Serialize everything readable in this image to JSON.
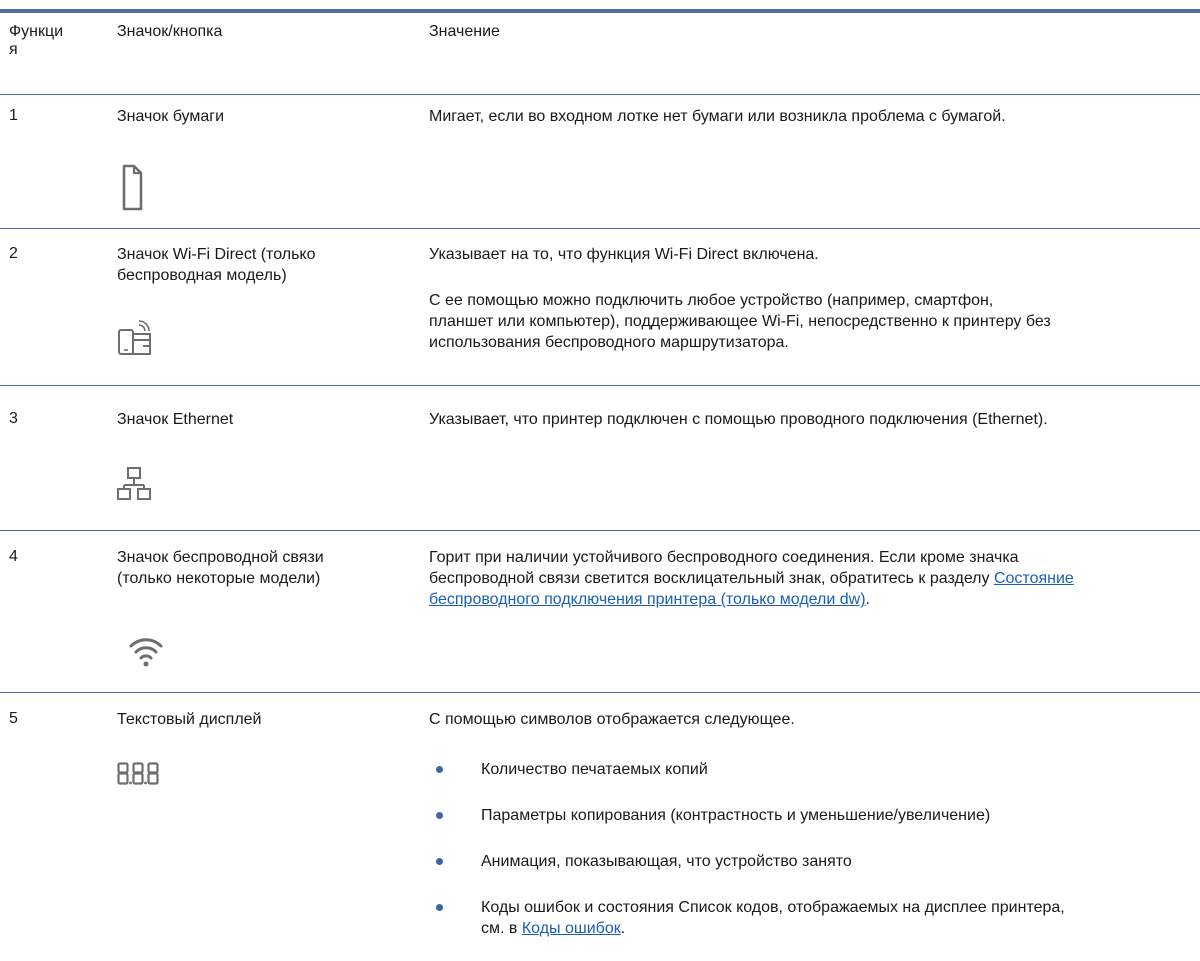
{
  "header": {
    "col_function": "Функци я",
    "col_function_line1": "Функци",
    "col_function_line2": "я",
    "col_icon": "Значок/кнопка",
    "col_meaning": "Значение"
  },
  "rows": [
    {
      "number": "1",
      "name": "Значок бумаги",
      "icon": "paper-icon",
      "meaning": "Мигает, если во входном лотке нет бумаги или возникла проблема с бумагой."
    },
    {
      "number": "2",
      "name_line1": "Значок Wi-Fi Direct (только",
      "name_line2": "беспроводная модель)",
      "icon": "wifi-direct-icon",
      "meaning_p1": "Указывает на то, что функция Wi-Fi Direct включена.",
      "meaning_p2_line1": "С ее помощью можно подключить любое устройство (например, смартфон,",
      "meaning_p2_line2": "планшет или компьютер), поддерживающее Wi-Fi, непосредственно к принтеру без",
      "meaning_p2_line3": "использования беспроводного маршрутизатора."
    },
    {
      "number": "3",
      "name": "Значок Ethernet",
      "icon": "ethernet-icon",
      "meaning": "Указывает, что принтер подключен с помощью проводного подключения (Ethernet)."
    },
    {
      "number": "4",
      "name_line1": "Значок беспроводной связи",
      "name_line2": "(только некоторые модели)",
      "icon": "wireless-icon",
      "meaning_line1": "Горит при наличии устойчивого беспроводного соединения. Если кроме значка",
      "meaning_line2_text": "беспроводной связи светится восклицательный знак, обратитесь к разделу ",
      "meaning_link_part1": "Состояние",
      "meaning_link_part2": "беспроводного подключения принтера (только модели dw)",
      "meaning_line3_tail": "."
    },
    {
      "number": "5",
      "name": "Текстовый дисплей",
      "icon": "segment-display-icon",
      "meaning_intro": "С помощью символов отображается следующее.",
      "bullets": [
        "Количество печатаемых копий",
        "Параметры копирования (контрастность и уменьшение/увеличение)",
        "Анимация, показывающая, что устройство занято"
      ],
      "last_bullet_line1": "Коды ошибок и состояния Список кодов, отображаемых на дисплее принтера,",
      "last_bullet_line2_prefix": "см. в ",
      "last_bullet_link": "Коды ошибок",
      "last_bullet_tail": "."
    }
  ],
  "colors": {
    "rule": "#4d6e96",
    "link": "#1a5fb4",
    "bullet": "#3b66a3",
    "icon_gray": "#6e6e6e"
  }
}
